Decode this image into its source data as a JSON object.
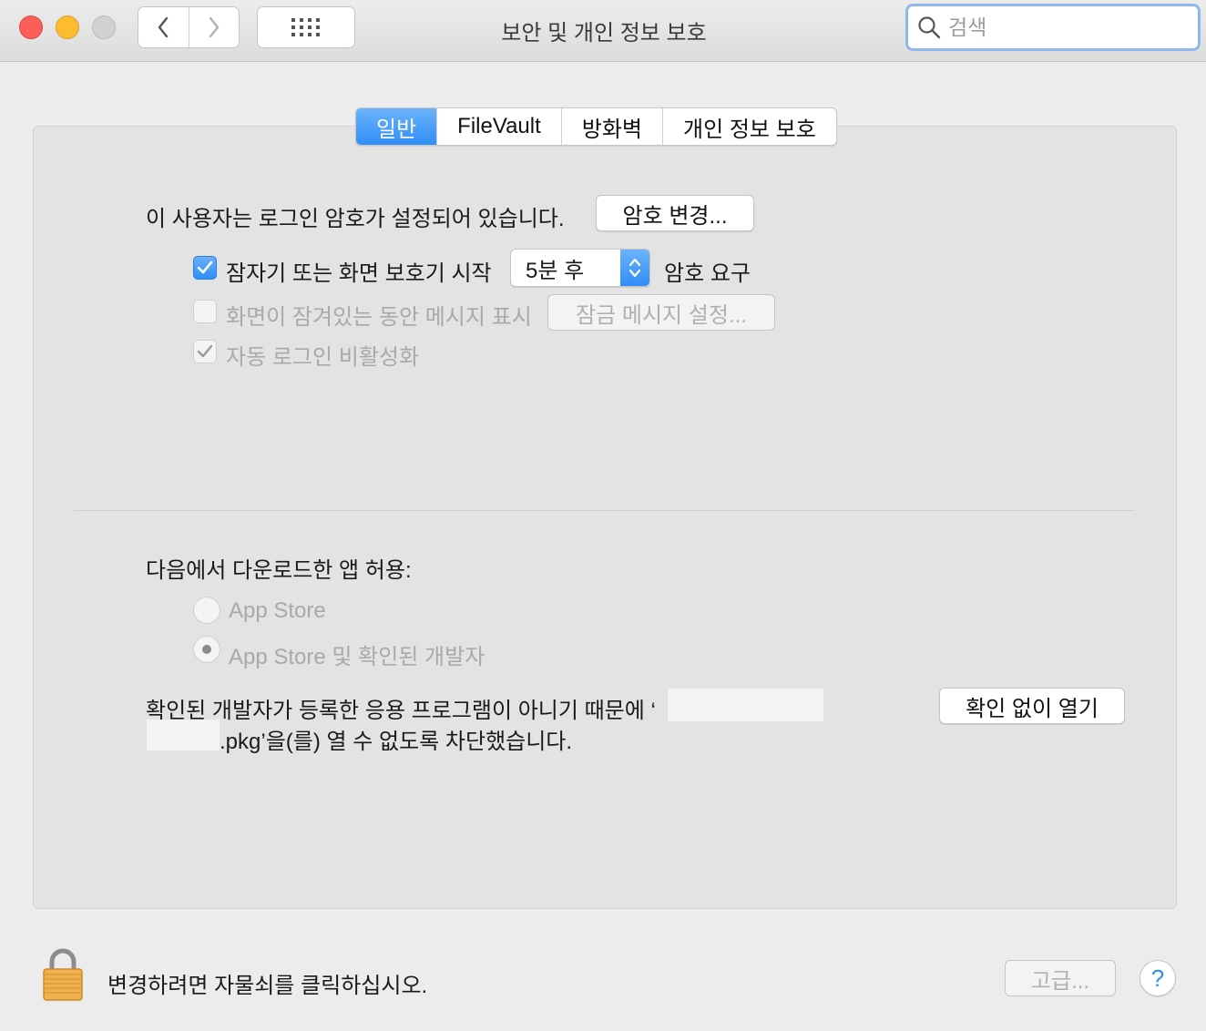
{
  "window": {
    "title": "보안 및 개인 정보 보호",
    "search_placeholder": "검색"
  },
  "tabs": [
    {
      "label": "일반",
      "active": true
    },
    {
      "label": "FileVault",
      "active": false
    },
    {
      "label": "방화벽",
      "active": false
    },
    {
      "label": "개인 정보 보호",
      "active": false
    }
  ],
  "general": {
    "password_set_text": "이 사용자는 로그인 암호가 설정되어 있습니다.",
    "change_password_button": "암호 변경...",
    "require_password": {
      "checked": true,
      "label": "잠자기 또는 화면 보호기 시작",
      "delay_value": "5분 후",
      "suffix": "암호 요구"
    },
    "show_message": {
      "checked": false,
      "enabled": false,
      "label": "화면이 잠겨있는 동안 메시지 표시",
      "button": "잠금 메시지 설정..."
    },
    "disable_auto_login": {
      "checked": true,
      "enabled": false,
      "label": "자동 로그인 비활성화"
    }
  },
  "downloads": {
    "heading": "다음에서 다운로드한 앱 허용:",
    "options": [
      {
        "label": "App Store",
        "selected": false
      },
      {
        "label": "App Store 및 확인된 개발자",
        "selected": true
      }
    ],
    "blocked_line1": "확인된 개발자가 등록한 응용 프로그램이 아니기 때문에 ‘",
    "blocked_line2": ".pkg’을(를) 열 수 없도록 차단했습니다.",
    "open_anyway_button": "확인 없이 열기"
  },
  "footer": {
    "lock_text": "변경하려면 자물쇠를 클릭하십시오.",
    "advanced_button": "고급...",
    "help_label": "?"
  },
  "icons": {
    "back": "chevron-left-icon",
    "forward": "chevron-right-icon",
    "grid": "grid-icon",
    "search": "search-icon",
    "lock": "lock-icon",
    "checkmark": "checkmark-icon"
  },
  "colors": {
    "accent": "#2f8ef6",
    "close": "#fc5f57",
    "minimize": "#fdbc2e",
    "lock_body": "#f3b14d"
  }
}
